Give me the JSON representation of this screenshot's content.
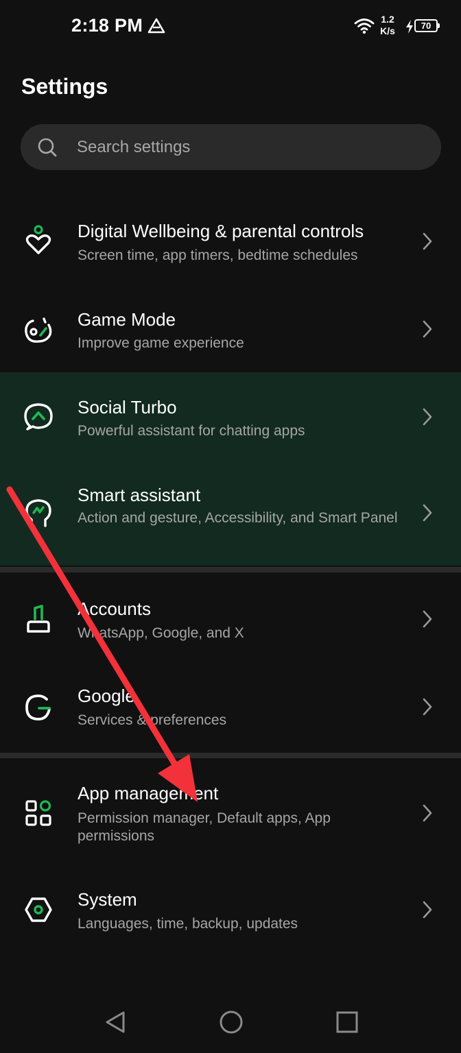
{
  "status_bar": {
    "time": "2:18 PM",
    "net_speed_value": "1.2",
    "net_speed_unit": "K/s",
    "battery_level": "70"
  },
  "page": {
    "title": "Settings"
  },
  "search": {
    "placeholder": "Search settings"
  },
  "items": [
    {
      "title": "Digital Wellbeing & parental controls",
      "subtitle": "Screen time, app timers, bedtime schedules",
      "icon": "heart-person-icon"
    },
    {
      "title": "Game Mode",
      "subtitle": "Improve game experience",
      "icon": "gamepad-icon"
    },
    {
      "title": "Social Turbo",
      "subtitle": "Powerful assistant for chatting apps",
      "icon": "chat-bubble-icon"
    },
    {
      "title": "Smart assistant",
      "subtitle": "Action and gesture, Accessibility, and Smart Panel",
      "icon": "assistant-head-icon"
    },
    {
      "title": "Accounts",
      "subtitle": "WhatsApp, Google, and X",
      "icon": "account-person-icon"
    },
    {
      "title": "Google",
      "subtitle": "Services & preferences",
      "icon": "google-icon"
    },
    {
      "title": "App management",
      "subtitle": "Permission manager, Default apps, App permissions",
      "icon": "apps-grid-icon"
    },
    {
      "title": "System",
      "subtitle": "Languages, time, backup, updates",
      "icon": "system-gear-icon"
    }
  ],
  "colors": {
    "background": "#111111",
    "accent": "#1db954",
    "highlight_row": "#122a1f",
    "annotation_arrow": "#f2313a"
  }
}
